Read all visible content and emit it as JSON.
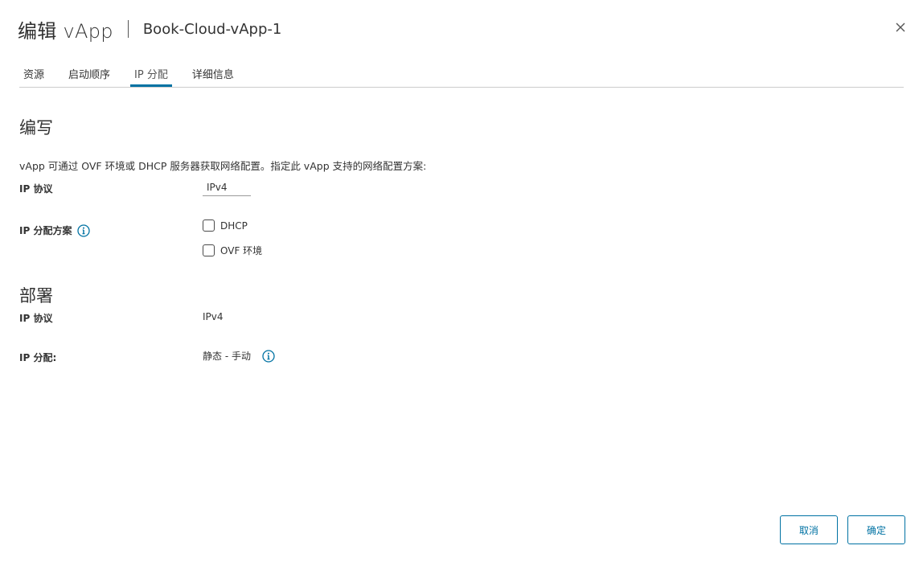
{
  "header": {
    "title": "编辑 vApp",
    "subtitle": "Book-Cloud-vApp-1"
  },
  "tabs": [
    {
      "label": "资源"
    },
    {
      "label": "启动顺序"
    },
    {
      "label": "IP 分配",
      "active": true
    },
    {
      "label": "详细信息"
    }
  ],
  "compose": {
    "title": "编写",
    "description": "vApp 可通过 OVF 环境或 DHCP 服务器获取网络配置。指定此 vApp 支持的网络配置方案:",
    "ip_protocol_label": "IP 协议",
    "ip_protocol_value": "IPv4",
    "ip_scheme_label": "IP 分配方案",
    "options": [
      {
        "label": "DHCP",
        "checked": false
      },
      {
        "label": "OVF 环境",
        "checked": false
      }
    ]
  },
  "deploy": {
    "title": "部署",
    "ip_protocol_label": "IP 协议",
    "ip_protocol_value": "IPv4",
    "ip_allocation_label": "IP 分配:",
    "ip_allocation_value": "静态 - 手动"
  },
  "footer": {
    "cancel_label": "取消",
    "ok_label": "确定"
  },
  "colors": {
    "accent": "#0072a3",
    "text": "#333333",
    "divider": "#cccccc"
  },
  "icons": {
    "close": "close-icon",
    "info": "info-icon"
  }
}
